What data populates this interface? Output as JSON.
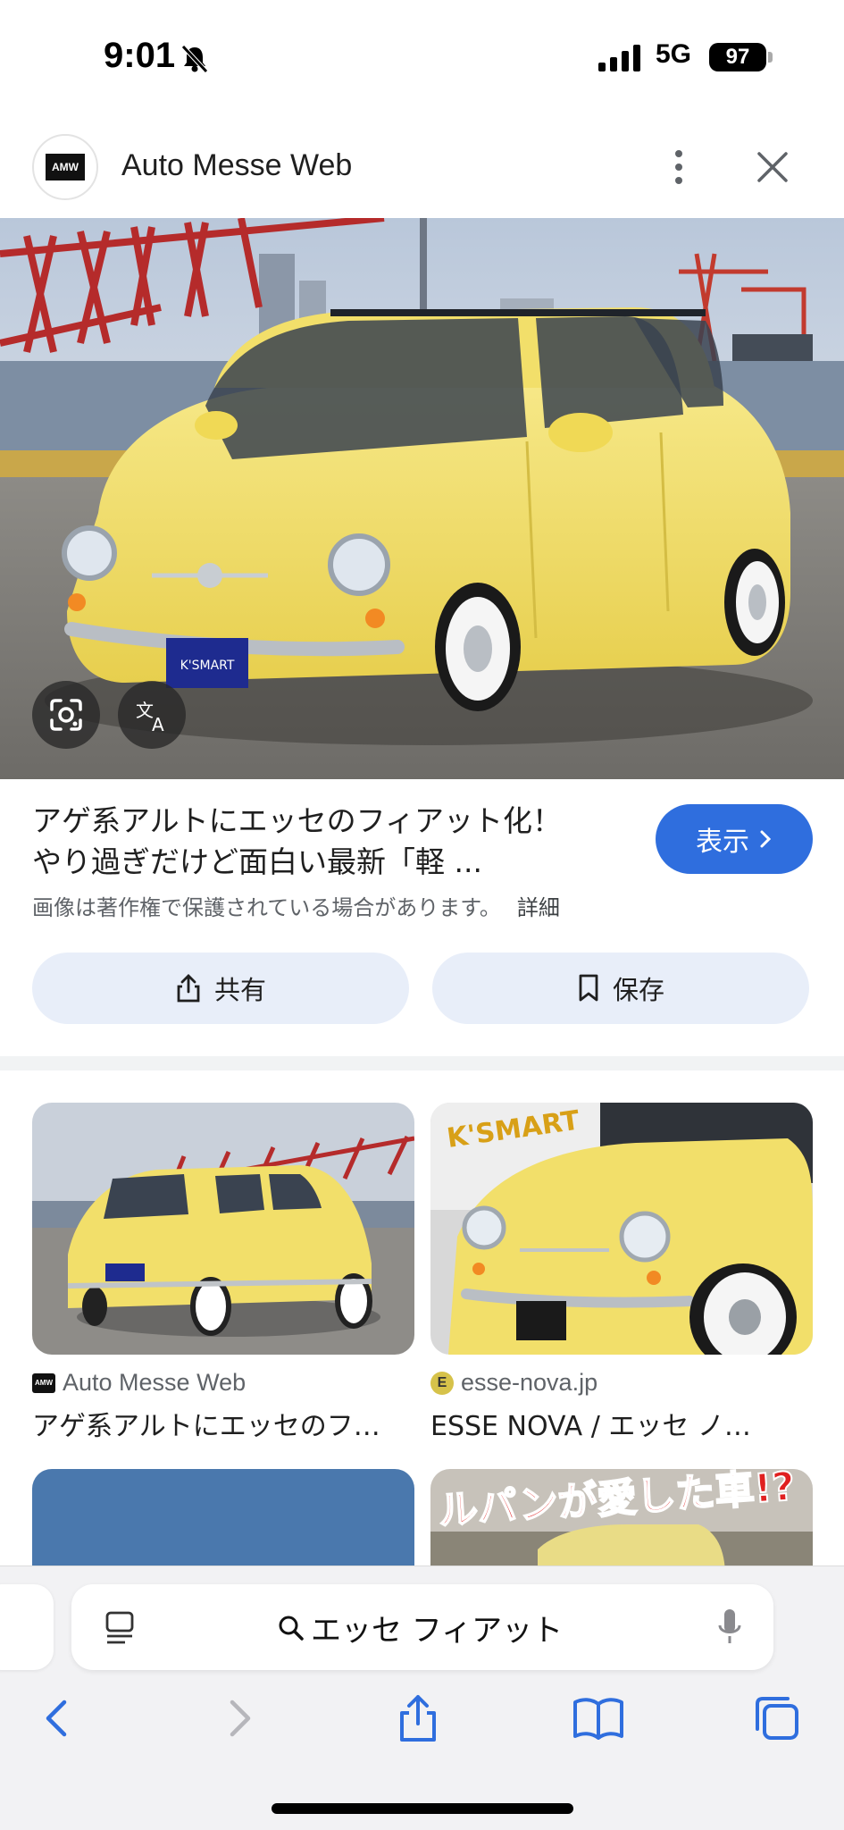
{
  "status_bar": {
    "time": "9:01",
    "network": "5G",
    "battery": "97"
  },
  "header": {
    "logo_text": "AMW",
    "site_name": "Auto Messe Web"
  },
  "result": {
    "title_line1": "アゲ系アルトにエッセのフィアット化！",
    "title_line2": "やり過ぎだけど面白い最新「軽 ...",
    "visit_label": "表示",
    "copyright": "画像は著作権で保護されている場合があります。",
    "copyright_more": "詳細",
    "share_label": "共有",
    "save_label": "保存"
  },
  "related": [
    {
      "source_icon": "AMW",
      "source": "Auto Messe Web",
      "title": "アゲ系アルトにエッセのフ…"
    },
    {
      "source_icon": "E",
      "source": "esse-nova.jp",
      "title": "ESSE NOVA / エッセ ノ…"
    },
    {
      "source_icon": "",
      "source": "",
      "title": ""
    },
    {
      "banner_text": "ルパンが愛した車!?"
    }
  ],
  "image_text": {
    "plate": "K'SMART",
    "card2_sign": "K'SMART"
  },
  "browser": {
    "search_query": "エッセ フィアット"
  },
  "colors": {
    "accent": "#2f6ede",
    "chip_bg": "#e8eef9",
    "car_yellow": "#f2df6a"
  }
}
